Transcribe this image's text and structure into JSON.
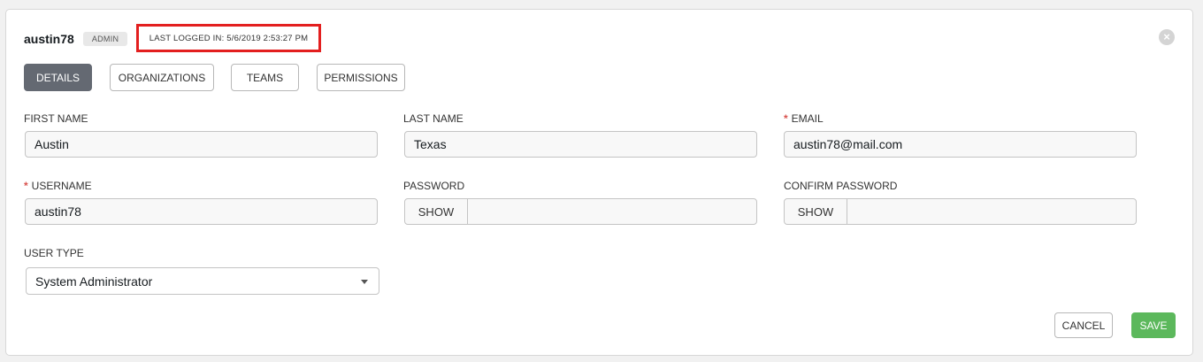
{
  "header": {
    "username": "austin78",
    "badge": "ADMIN",
    "last_logged_in": "LAST LOGGED IN: 5/6/2019 2:53:27 PM",
    "close_icon": "close-circle-icon"
  },
  "tabs": [
    {
      "label": "DETAILS",
      "active": true
    },
    {
      "label": "ORGANIZATIONS",
      "active": false
    },
    {
      "label": "TEAMS",
      "active": false
    },
    {
      "label": "PERMISSIONS",
      "active": false
    }
  ],
  "form": {
    "first_name": {
      "label": "FIRST NAME",
      "value": "Austin"
    },
    "last_name": {
      "label": "LAST NAME",
      "value": "Texas"
    },
    "email": {
      "label": "EMAIL",
      "value": "austin78@mail.com",
      "required": "*"
    },
    "username": {
      "label": "USERNAME",
      "value": "austin78",
      "required": "*"
    },
    "password": {
      "label": "PASSWORD",
      "show_label": "SHOW",
      "value": ""
    },
    "confirm_password": {
      "label": "CONFIRM PASSWORD",
      "show_label": "SHOW",
      "value": ""
    },
    "user_type": {
      "label": "USER TYPE",
      "value": "System Administrator"
    }
  },
  "actions": {
    "cancel": "CANCEL",
    "save": "SAVE"
  },
  "colors": {
    "active_tab": "#646972",
    "save": "#5cb85c",
    "required": "#d9534f",
    "highlight": "#e31f1f"
  }
}
